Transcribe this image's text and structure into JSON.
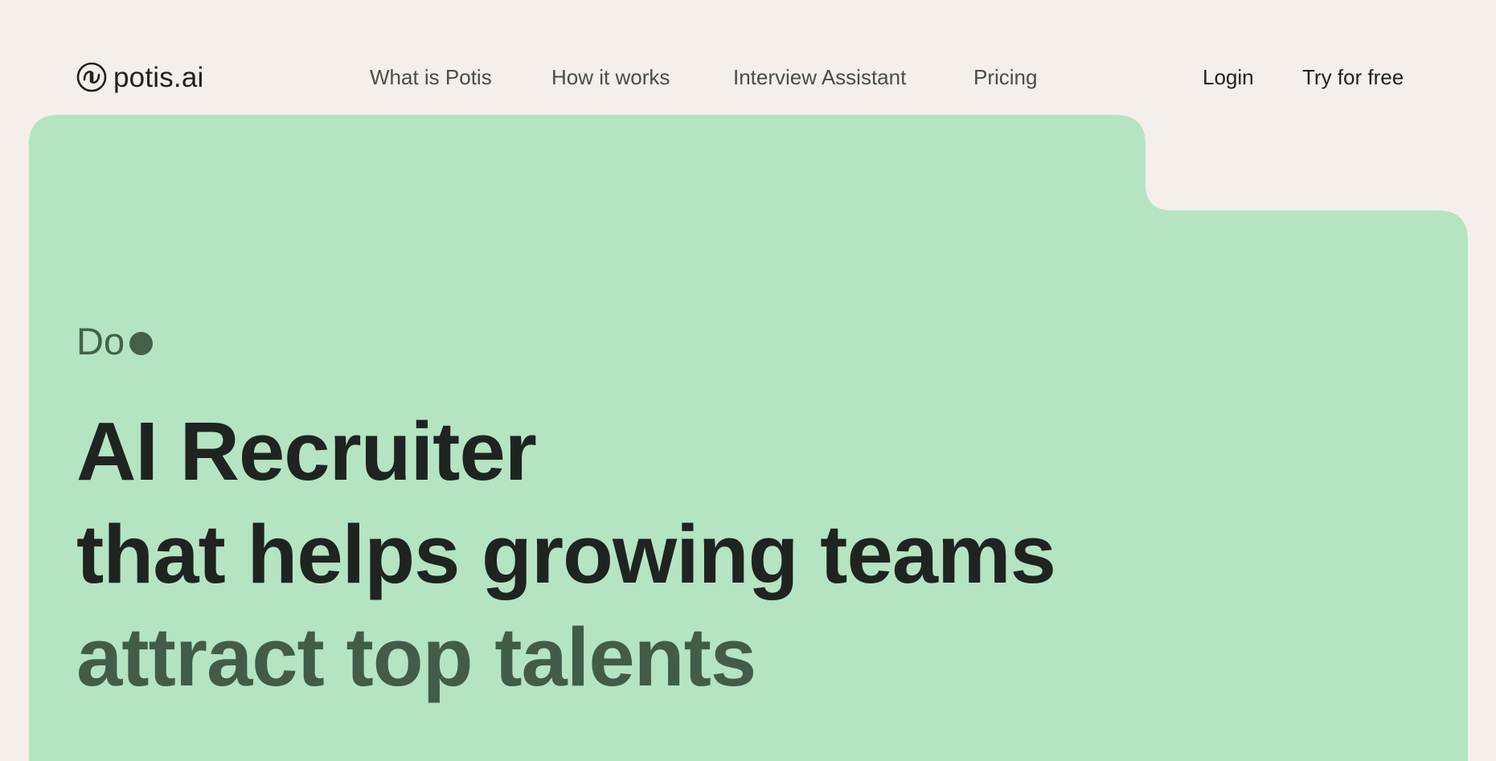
{
  "brand": {
    "name": "potis.ai",
    "logo_icon": "potis-logo-icon"
  },
  "nav": {
    "items": [
      {
        "label": "What is Potis"
      },
      {
        "label": "How it works"
      },
      {
        "label": "Interview Assistant"
      },
      {
        "label": "Pricing"
      }
    ]
  },
  "auth": {
    "login_label": "Login",
    "try_label": "Try for free"
  },
  "hero": {
    "kicker": "Do",
    "headline_line1": "AI Recruiter",
    "headline_line2": "that helps growing teams",
    "headline_line3": "attract top talents"
  },
  "colors": {
    "page_background": "#f4efea",
    "hero_background": "#b5e4c2",
    "accent_green": "#415d47",
    "text_dark": "#1f2420",
    "nav_text": "#494c4a"
  }
}
